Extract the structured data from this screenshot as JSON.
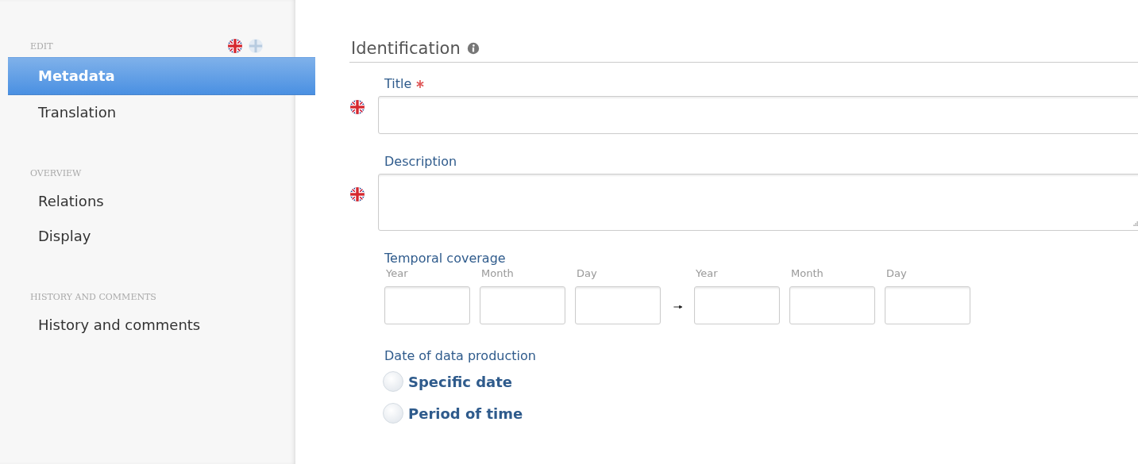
{
  "sidebar": {
    "sections": [
      {
        "heading": "EDIT",
        "language_flags": true,
        "items": [
          {
            "label": "Metadata",
            "selected": true
          },
          {
            "label": "Translation",
            "selected": false
          }
        ]
      },
      {
        "heading": "OVERVIEW",
        "items": [
          {
            "label": "Relations",
            "selected": false
          },
          {
            "label": "Display",
            "selected": false
          }
        ]
      },
      {
        "heading": "HISTORY AND COMMENTS",
        "items": [
          {
            "label": "History and comments",
            "selected": false
          }
        ]
      }
    ]
  },
  "main": {
    "heading": "Identification",
    "fields": [
      {
        "kind": "text",
        "label": "Title",
        "required": true,
        "language_flag": true
      },
      {
        "kind": "textarea",
        "label": "Description",
        "required": false,
        "language_flag": true
      },
      {
        "kind": "daterange",
        "label": "Temporal coverage",
        "start": [
          "Year",
          "Month",
          "Day"
        ],
        "end": [
          "Year",
          "Month",
          "Day"
        ]
      },
      {
        "kind": "radio",
        "label": "Date of data production",
        "options": [
          {
            "label": "Specific date",
            "selected": false
          },
          {
            "label": "Period of time",
            "selected": false
          }
        ]
      }
    ]
  }
}
